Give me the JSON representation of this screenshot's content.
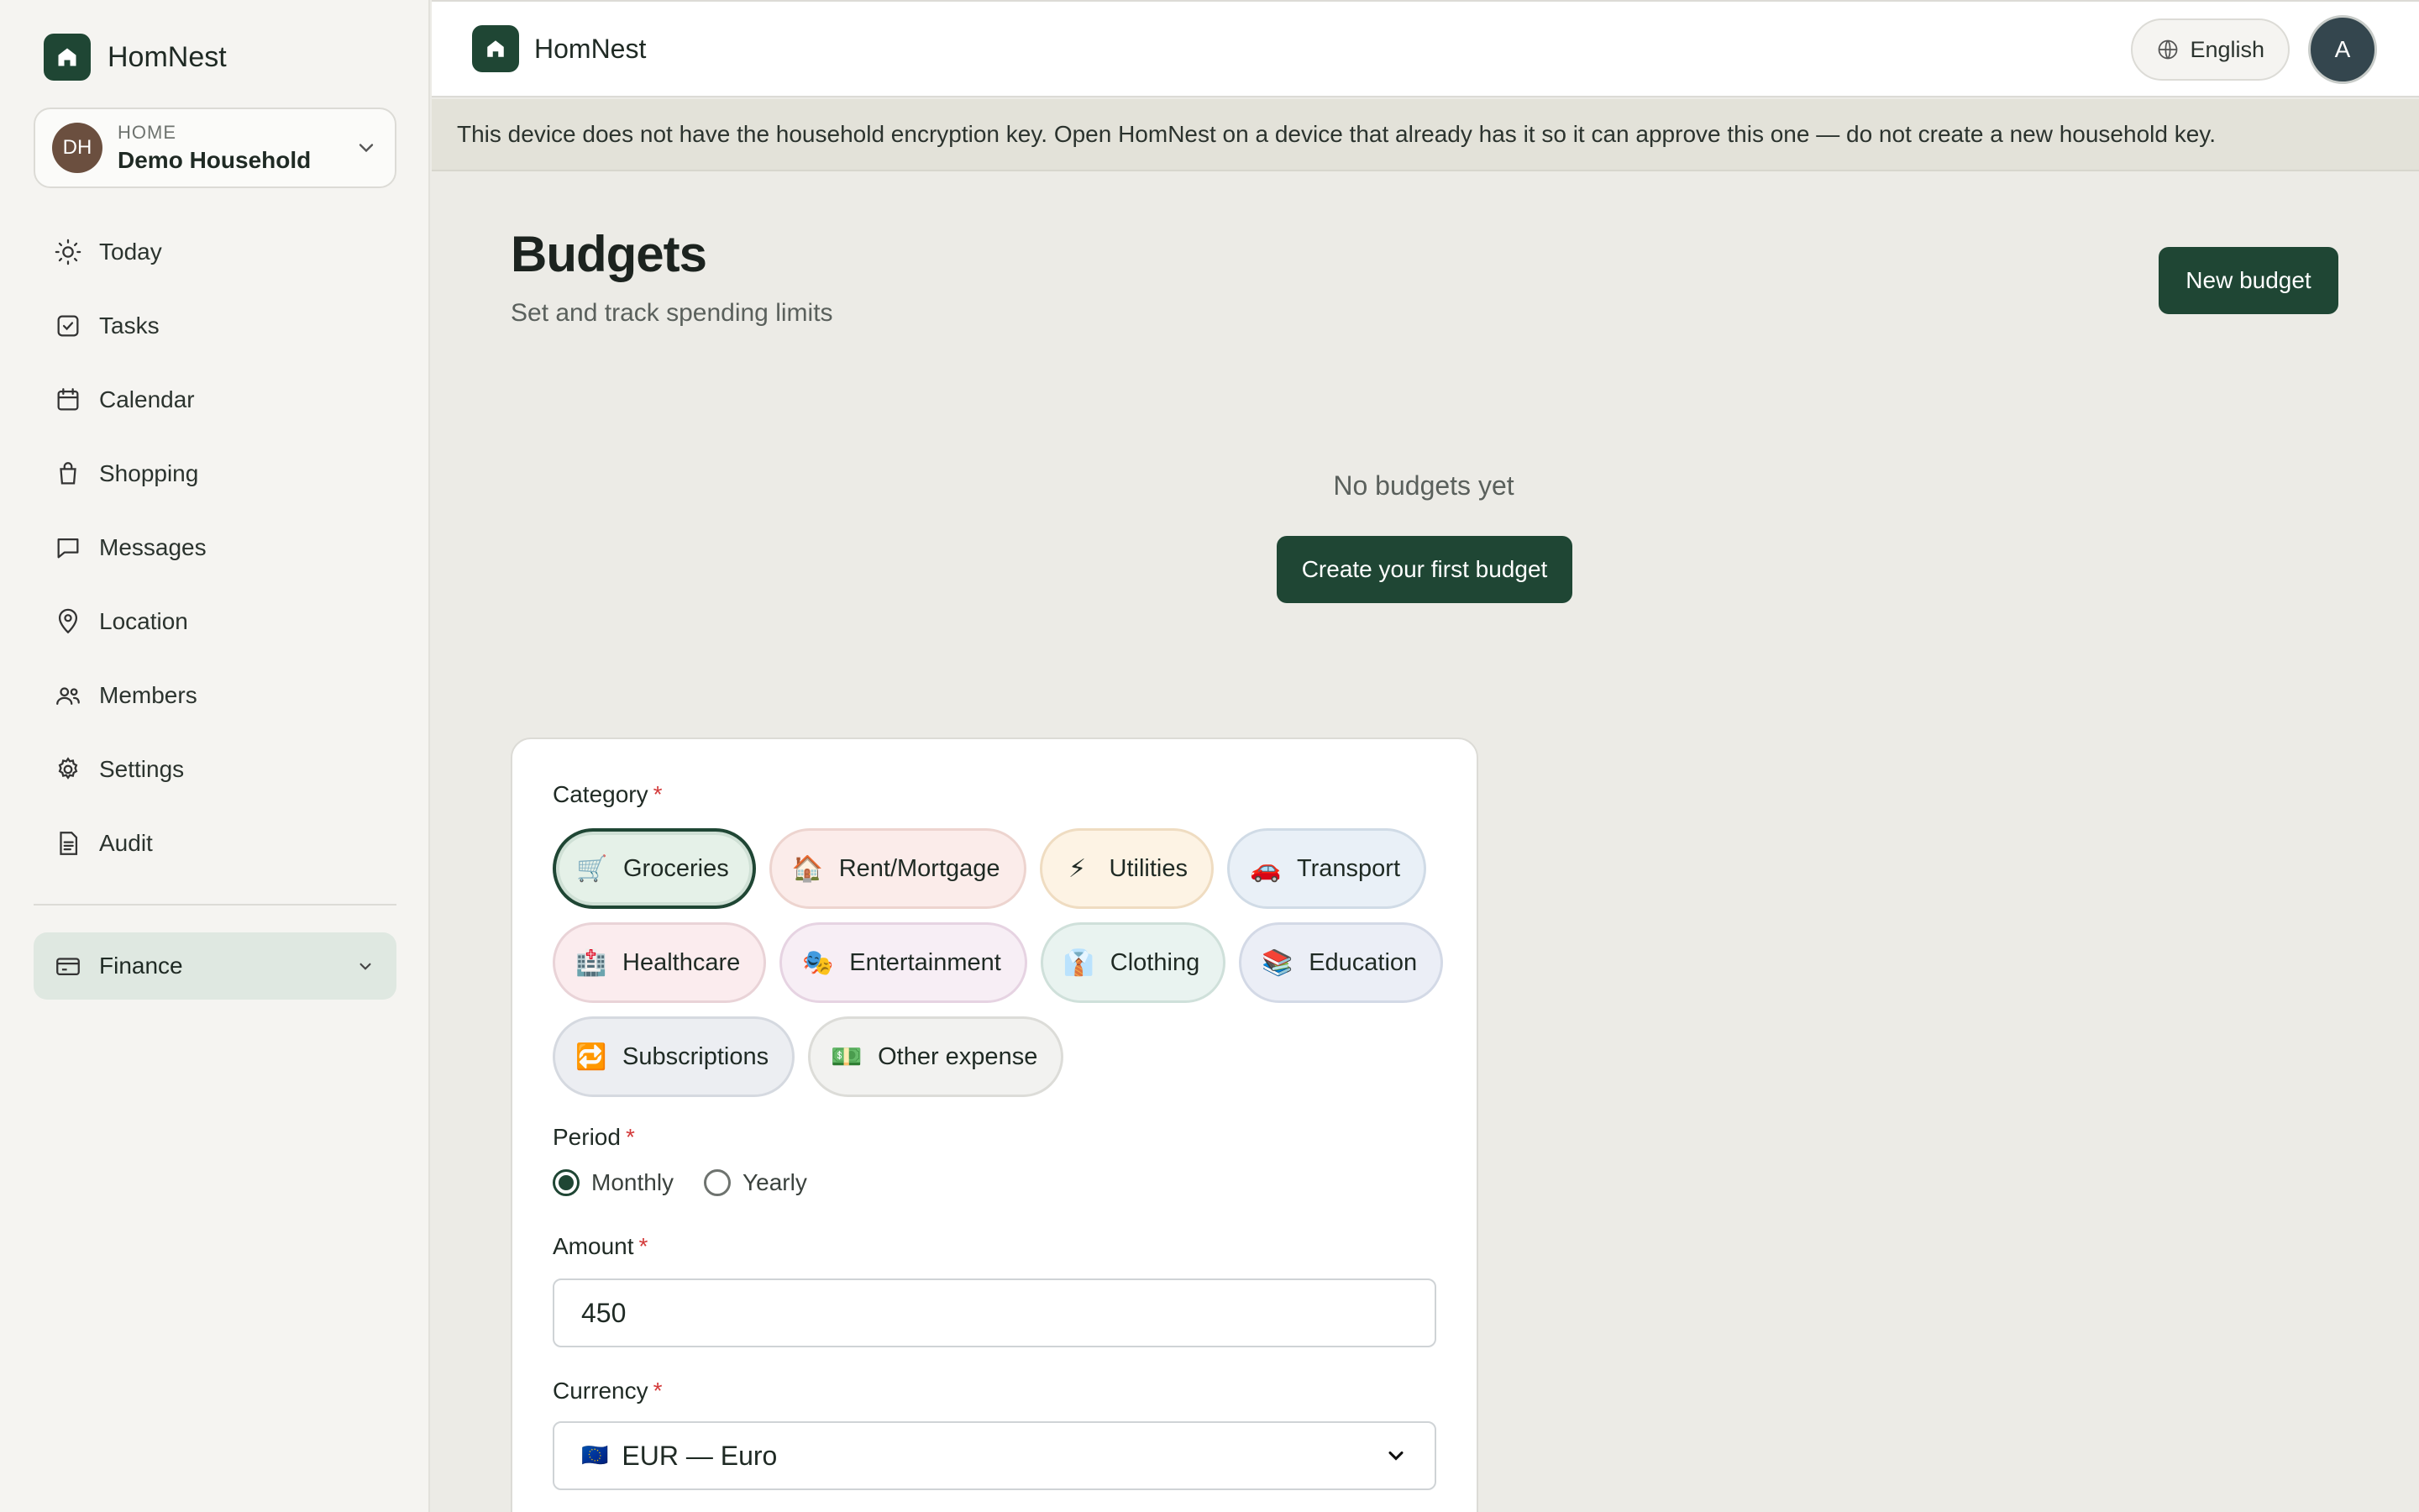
{
  "app": {
    "name": "HomNest"
  },
  "household": {
    "label": "HOME",
    "name": "Demo Household",
    "initials": "DH"
  },
  "nav": [
    {
      "label": "Today",
      "icon": "sun-icon"
    },
    {
      "label": "Tasks",
      "icon": "checkbox-icon"
    },
    {
      "label": "Calendar",
      "icon": "calendar-icon"
    },
    {
      "label": "Shopping",
      "icon": "shopping-bag-icon"
    },
    {
      "label": "Messages",
      "icon": "message-icon"
    },
    {
      "label": "Location",
      "icon": "map-pin-icon"
    },
    {
      "label": "Members",
      "icon": "users-icon"
    },
    {
      "label": "Settings",
      "icon": "gear-icon"
    },
    {
      "label": "Audit",
      "icon": "document-icon"
    }
  ],
  "finance": {
    "label": "Finance",
    "icon": "credit-card-icon"
  },
  "topbar": {
    "language": "English",
    "avatar_initial": "A"
  },
  "banner": {
    "text": "This device does not have the household encryption key. Open HomNest on a device that already has it so it can approve this one — do not create a new household key."
  },
  "page": {
    "title": "Budgets",
    "subtitle": "Set and track spending limits",
    "new_button": "New budget",
    "empty_text": "No budgets yet",
    "create_first_button": "Create your first budget"
  },
  "form": {
    "category_label": "Category",
    "required_mark": "*",
    "categories": [
      {
        "label": "Groceries",
        "emoji": "🛒",
        "bg": "#e5f1e8",
        "border": "#1f4634",
        "selected": true
      },
      {
        "label": "Rent/Mortgage",
        "emoji": "🏠",
        "bg": "#fbecea",
        "border": "#edd4cf"
      },
      {
        "label": "Utilities",
        "emoji": "⚡",
        "bg": "#fdf3e4",
        "border": "#efdcc1"
      },
      {
        "label": "Transport",
        "emoji": "🚗",
        "bg": "#e9f0f7",
        "border": "#d0dbe6"
      },
      {
        "label": "Healthcare",
        "emoji": "🏥",
        "bg": "#fbecee",
        "border": "#e9d3d7"
      },
      {
        "label": "Entertainment",
        "emoji": "🎭",
        "bg": "#f7eef5",
        "border": "#e6d3e2"
      },
      {
        "label": "Clothing",
        "emoji": "👔",
        "bg": "#e9f3f0",
        "border": "#cfe0da"
      },
      {
        "label": "Education",
        "emoji": "📚",
        "bg": "#ebeef6",
        "border": "#d3d9e6"
      },
      {
        "label": "Subscriptions",
        "emoji": "🔁",
        "bg": "#eceef2",
        "border": "#d5d9e0"
      },
      {
        "label": "Other expense",
        "emoji": "💵",
        "bg": "#f2f2f0",
        "border": "#dcdcd8"
      }
    ],
    "period_label": "Period",
    "period_options": [
      "Monthly",
      "Yearly"
    ],
    "period_selected": "Monthly",
    "amount_label": "Amount",
    "amount_value": "450",
    "currency_label": "Currency",
    "currency_flag": "🇪🇺",
    "currency_value": "EUR — Euro"
  },
  "colors": {
    "accent": "#1f4634",
    "required": "#d33a3a",
    "background": "#ecebe6"
  }
}
